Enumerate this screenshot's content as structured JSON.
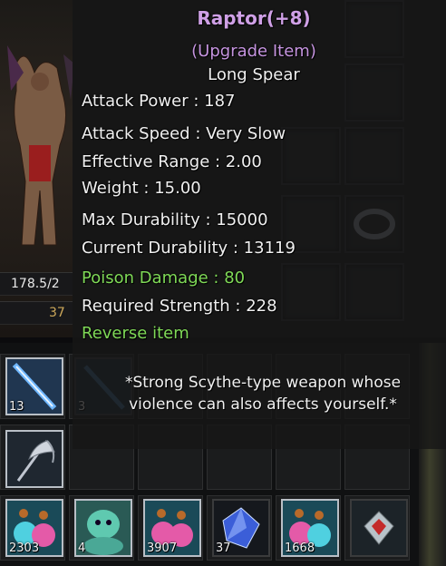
{
  "character": {
    "weight_value": "178.5/2",
    "gold_value": "37"
  },
  "tooltip": {
    "title": "Raptor(+8)",
    "upgrade_tag": "(Upgrade Item)",
    "item_type": "Long Spear",
    "stats": [
      {
        "text": "Attack Power : 187",
        "color": "white"
      },
      {
        "text": "Attack Speed : Very Slow",
        "color": "white"
      },
      {
        "text": "Effective Range : 2.00",
        "color": "white"
      },
      {
        "text": "Weight : 15.00",
        "color": "white"
      },
      {
        "text": "Max Durability : 15000",
        "color": "white"
      },
      {
        "text": "Current Durability : 13119",
        "color": "white"
      },
      {
        "text": "Poison Damage : 80",
        "color": "green"
      },
      {
        "text": "Required Strength : 228",
        "color": "white"
      },
      {
        "text": "Reverse item",
        "color": "green"
      }
    ],
    "description": "*Strong Scythe-type weapon whose violence can also affects yourself.*"
  },
  "bag": {
    "row1": [
      {
        "icon": "spear-icon",
        "qty": "13"
      },
      {
        "icon": "spear-icon",
        "qty": "3"
      }
    ],
    "row2": [
      {
        "icon": "scythe-icon",
        "qty": ""
      }
    ],
    "row3": [
      {
        "icon": "potion-icon",
        "qty": "2303"
      },
      {
        "icon": "ogre-icon",
        "qty": "4"
      },
      {
        "icon": "potion-icon",
        "qty": "3907"
      },
      {
        "icon": "crystal-icon",
        "qty": "37"
      },
      {
        "icon": "potion-icon",
        "qty": "1668"
      },
      {
        "icon": "red-gem-icon",
        "qty": ""
      }
    ]
  },
  "colors": {
    "title": "#cfa0e6",
    "upgrade": "#c594df",
    "green_stat": "#7fd957",
    "text": "#f0f0f0"
  }
}
